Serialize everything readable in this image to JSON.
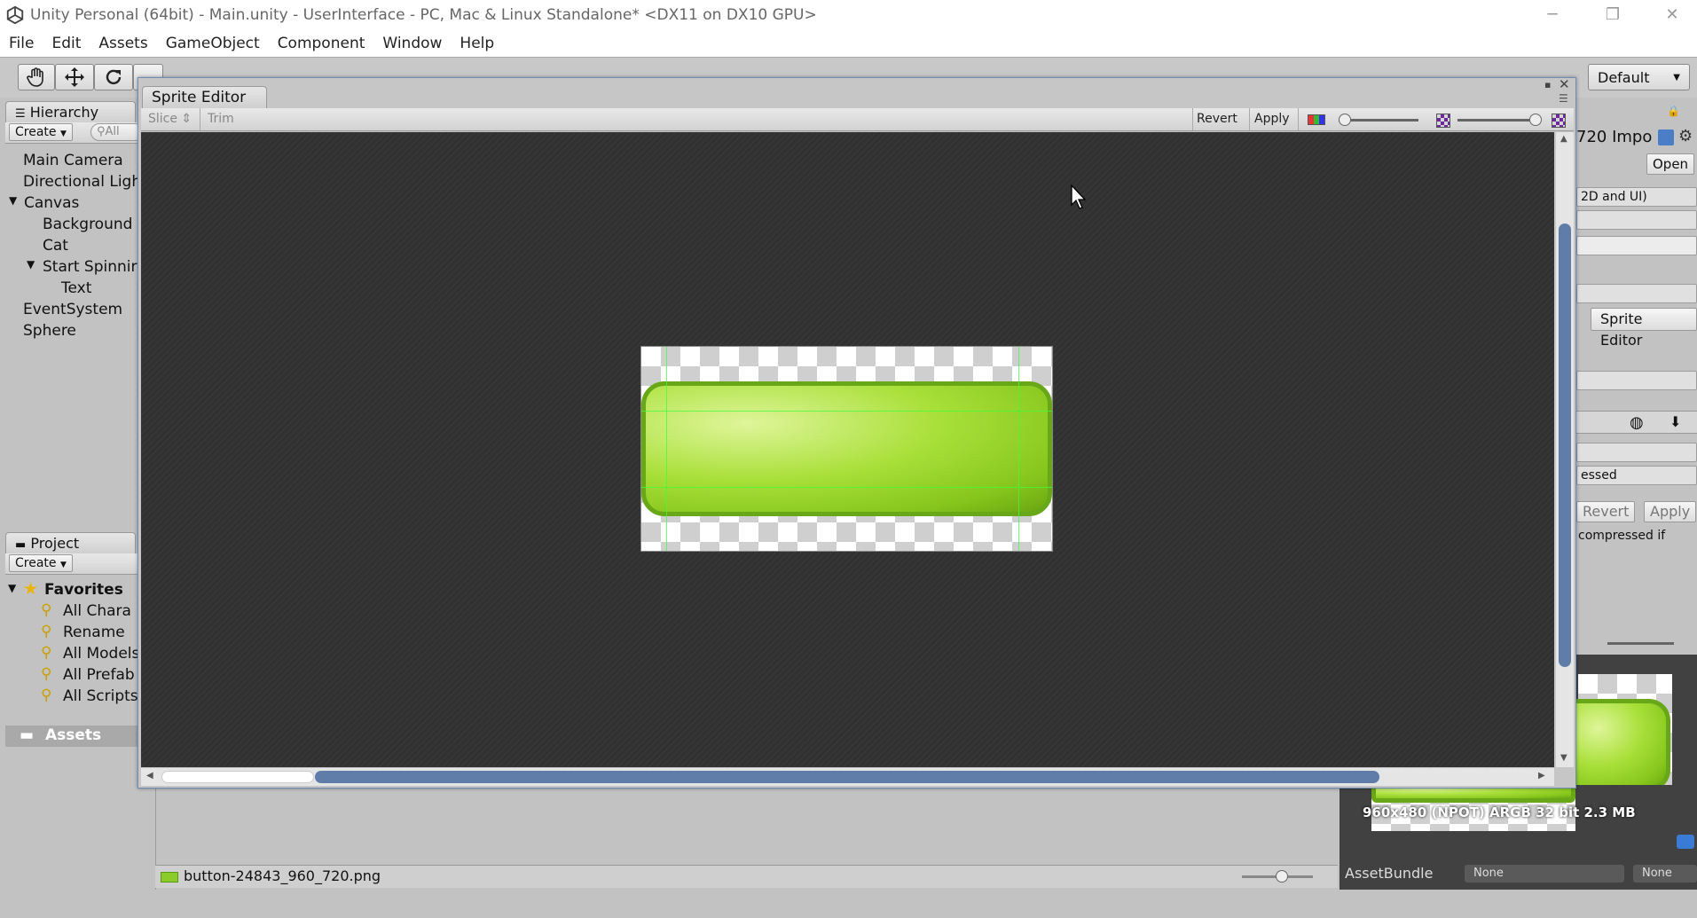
{
  "window": {
    "title": "Unity Personal (64bit) - Main.unity - UserInterface - PC, Mac & Linux Standalone* <DX11 on DX10 GPU>",
    "minimize": "─",
    "restore": "❐",
    "close": "✕"
  },
  "menu": [
    "File",
    "Edit",
    "Assets",
    "GameObject",
    "Component",
    "Window",
    "Help"
  ],
  "toolbar": {
    "layout_label": "Default"
  },
  "hierarchy": {
    "tab_label": "Hierarchy",
    "create_label": "Create",
    "search_placeholder": "All",
    "items": [
      {
        "label": "Main Camera",
        "indent": 0,
        "expander": ""
      },
      {
        "label": "Directional Ligh",
        "indent": 0,
        "expander": ""
      },
      {
        "label": "Canvas",
        "indent": 0,
        "expander": "▼"
      },
      {
        "label": "Background",
        "indent": 1,
        "expander": ""
      },
      {
        "label": "Cat",
        "indent": 1,
        "expander": ""
      },
      {
        "label": "Start Spinnir",
        "indent": 1,
        "expander": "▼"
      },
      {
        "label": "Text",
        "indent": 2,
        "expander": ""
      },
      {
        "label": "EventSystem",
        "indent": 0,
        "expander": ""
      },
      {
        "label": "Sphere",
        "indent": 0,
        "expander": ""
      }
    ]
  },
  "project": {
    "tab_label": "Project",
    "create_label": "Create",
    "favorites_label": "Favorites",
    "favorites": [
      "All Chara",
      "Rename",
      "All Models",
      "All Prefab",
      "All Scripts"
    ],
    "assets_label": "Assets",
    "selected_file": "button-24843_960_720.png"
  },
  "sprite_editor": {
    "title": "Sprite Editor",
    "slice_label": "Slice",
    "trim_label": "Trim",
    "revert_label": "Revert",
    "apply_label": "Apply"
  },
  "inspector": {
    "title_fragment": "720 Impo",
    "open_label": "Open",
    "texture_type": "2D and UI)",
    "sprite_editor_button": "Sprite Editor",
    "format_fragment": "essed",
    "revert_label": "Revert",
    "apply_label": "Apply",
    "note_fragment": "compressed if",
    "preview_info": "960x480 (NPOT)  ARGB 32 bit   2.3 MB",
    "assetbundle_label": "AssetBundle",
    "assetbundle_value": "None",
    "assetbundle_variant": "None"
  }
}
